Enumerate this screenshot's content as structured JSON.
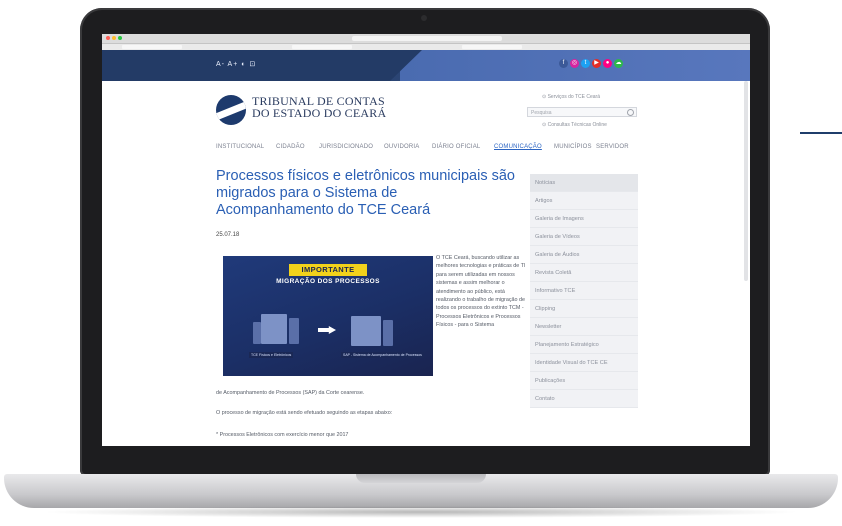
{
  "topbar": {
    "accessibility": "A- A+ ◐ ⊡",
    "social_icons": [
      {
        "name": "facebook-icon",
        "color": "#3b5998",
        "glyph": "f"
      },
      {
        "name": "instagram-icon",
        "color": "#d6249f",
        "glyph": "◎"
      },
      {
        "name": "twitter-icon",
        "color": "#1da1f2",
        "glyph": "t"
      },
      {
        "name": "youtube-icon",
        "color": "#e52d27",
        "glyph": "▶"
      },
      {
        "name": "flickr-icon",
        "color": "#ff0084",
        "glyph": "●"
      },
      {
        "name": "soundcloud-icon",
        "color": "#2db84c",
        "glyph": "☁"
      }
    ]
  },
  "header": {
    "logo_line1": "TRIBUNAL DE CONTAS",
    "logo_line2": "DO ESTADO DO CEARÁ",
    "servicos_link": "⊙ Serviços do TCE Ceará",
    "search_placeholder": "Pesquisa",
    "consultas_link": "⊙ Consultas Técnicas Online"
  },
  "nav": [
    {
      "label": "INSTITUCIONAL",
      "active": false
    },
    {
      "label": "CIDADÃO",
      "active": false
    },
    {
      "label": "JURISDICIONADO",
      "active": false
    },
    {
      "label": "OUVIDORIA",
      "active": false
    },
    {
      "label": "DIÁRIO OFICIAL",
      "active": false
    },
    {
      "label": "COMUNICAÇÃO",
      "active": true
    },
    {
      "label": "MUNICÍPIOS",
      "active": false
    },
    {
      "label": "SERVIDOR",
      "active": false
    }
  ],
  "article": {
    "title": "Processos físicos e eletrônicos municipais são migrados para o Sistema de Acompanhamento do TCE Ceará",
    "date": "25.07.18",
    "banner": {
      "tag": "IMPORTANTE",
      "subtitle": "MIGRAÇÃO DOS PROCESSOS",
      "caption_left": "TCE Físicos e Eletrônicos",
      "caption_right": "SAP - Sistema de Acompanhamento de Processos"
    },
    "side_text": "O TCE Ceará, buscando utilizar as melhores tecnologias e práticas de TI para serem utilizadas em nossos sistemas e assim melhorar o atendimento ao público, está realizando o trabalho de migração de todos os processos do extinto TCM - Processos Eletrônicos e Processos Físicos - para o Sistema",
    "continuation": "de Acompanhamento de Processos (SAP) da Corte cearense.",
    "paragraph2": "O processo de migração está sendo efetuado seguindo as etapas abaixo:",
    "paragraph3": "* Processos Eletrônicos com exercício menor que 2017"
  },
  "sidebar": [
    "Notícias",
    "Artigos",
    "Galeria de Imagens",
    "Galeria de Vídeos",
    "Galeria de Áudios",
    "Revista Coletâ",
    "Informativo TCE",
    "Clipping",
    "Newsletter",
    "Planejamento Estratégico",
    "Identidade Visual do TCE CE",
    "Publicações",
    "Contato"
  ]
}
